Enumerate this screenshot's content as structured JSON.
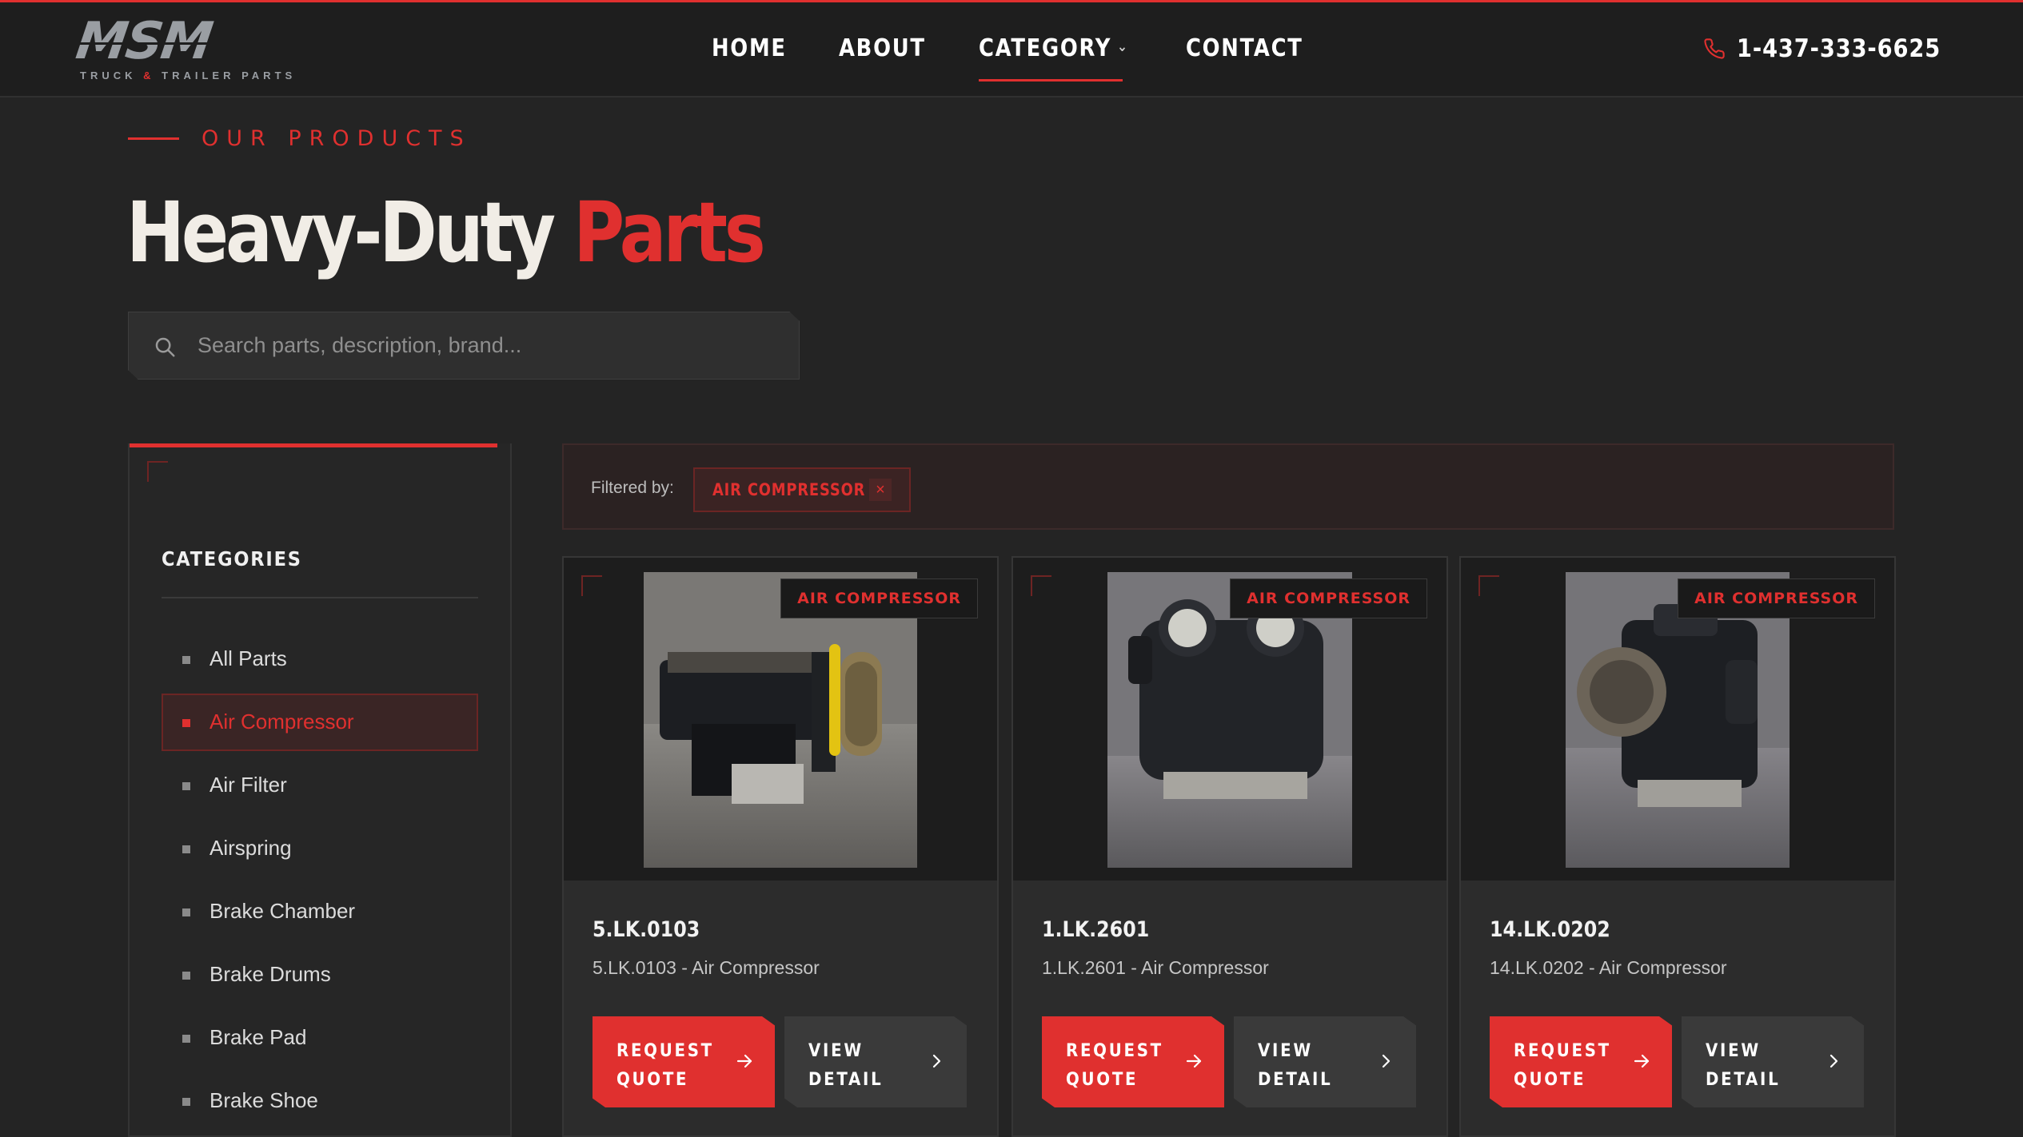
{
  "brand": {
    "logo_text": "MSM",
    "logo_sub_before": "TRUCK",
    "logo_sub_amp": "&",
    "logo_sub_after": "TRAILER PARTS",
    "accent_color": "#e0302f"
  },
  "nav": {
    "items": [
      {
        "label": "HOME"
      },
      {
        "label": "ABOUT"
      },
      {
        "label": "CATEGORY",
        "has_dropdown": true,
        "active": true
      },
      {
        "label": "CONTACT"
      }
    ],
    "phone": "1-437-333-6625"
  },
  "hero": {
    "eyebrow": "OUR PRODUCTS",
    "title_main": "Heavy-Duty",
    "title_accent": "Parts"
  },
  "search": {
    "placeholder": "Search parts, description, brand...",
    "value": ""
  },
  "sidebar": {
    "title": "CATEGORIES",
    "items": [
      {
        "label": "All Parts",
        "active": false
      },
      {
        "label": "Air Compressor",
        "active": true
      },
      {
        "label": "Air Filter",
        "active": false
      },
      {
        "label": "Airspring",
        "active": false
      },
      {
        "label": "Brake Chamber",
        "active": false
      },
      {
        "label": "Brake Drums",
        "active": false
      },
      {
        "label": "Brake Pad",
        "active": false
      },
      {
        "label": "Brake Shoe",
        "active": false
      }
    ]
  },
  "filter": {
    "label": "Filtered by:",
    "chip": "AIR COMPRESSOR",
    "chip_remove": "×"
  },
  "products": [
    {
      "badge": "AIR COMPRESSOR",
      "sku": "5.LK.0103",
      "description": "5.LK.0103 - Air Compressor",
      "request_label": "REQUEST\nQUOTE",
      "view_label": "VIEW\nDETAIL"
    },
    {
      "badge": "AIR COMPRESSOR",
      "sku": "1.LK.2601",
      "description": "1.LK.2601 - Air Compressor",
      "request_label": "REQUEST\nQUOTE",
      "view_label": "VIEW\nDETAIL"
    },
    {
      "badge": "AIR COMPRESSOR",
      "sku": "14.LK.0202",
      "description": "14.LK.0202 - Air Compressor",
      "request_label": "REQUEST\nQUOTE",
      "view_label": "VIEW\nDETAIL"
    }
  ]
}
